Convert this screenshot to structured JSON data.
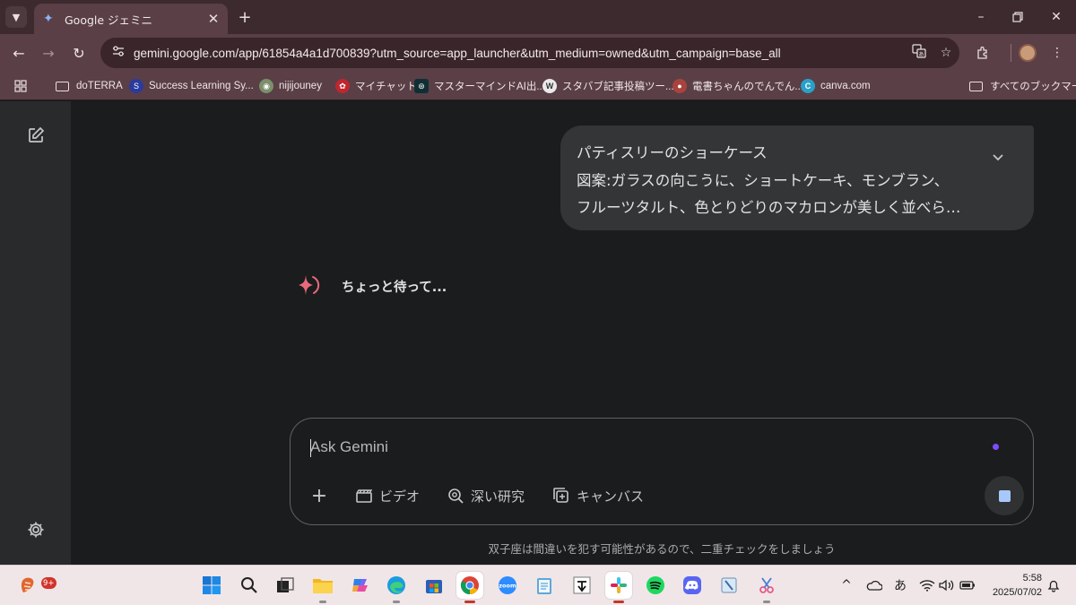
{
  "browser": {
    "tab": {
      "title": "Google ジェミニ",
      "favicon": "gemini-sparkle-icon",
      "close_glyph": "✕"
    },
    "new_tab_glyph": "+",
    "url": "gemini.google.com/app/61854a4a1d700839?utm_source=app_launcher&utm_medium=owned&utm_campaign=base_all",
    "bookmarks": [
      {
        "label": "doTERRA",
        "icon": "folder-icon"
      },
      {
        "label": "Success Learning Sy...",
        "icon": "s-logo-icon"
      },
      {
        "label": "nijijouney",
        "icon": "niji-icon"
      },
      {
        "label": "マイチャット",
        "icon": "mychat-icon"
      },
      {
        "label": "マスターマインドAI出...",
        "icon": "mastermind-icon"
      },
      {
        "label": "スタバブ記事投稿ツー...",
        "icon": "wordpress-icon"
      },
      {
        "label": "電書ちゃんのでんでん...",
        "icon": "denden-icon"
      },
      {
        "label": "canva.com",
        "icon": "canva-icon"
      }
    ],
    "all_bookmarks": "すべてのブックマーク"
  },
  "conversation": {
    "user_message_lines": [
      "パティスリーのショーケース",
      "図案:ガラスの向こうに、ショートケーキ、モンブラン、",
      "フルーツタルト、色とりどりのマカロンが美しく並べら…"
    ],
    "status_text": "ちょっと待って..."
  },
  "composer": {
    "placeholder": "Ask Gemini",
    "tools": [
      {
        "label": "ビデオ",
        "icon": "video-icon"
      },
      {
        "label": "深い研究",
        "icon": "deep-research-icon"
      },
      {
        "label": "キャンバス",
        "icon": "canvas-icon"
      }
    ]
  },
  "disclaimer": "双子座は間違いを犯す可能性があるので、二重チェックをしましょう",
  "taskbar": {
    "notification_badge": "9+",
    "ime_label": "あ",
    "time": "5:58",
    "date": "2025/07/02"
  },
  "colors": {
    "chrome_tab_strip": "#3c2a2e",
    "chrome_toolbar": "#5a3f46",
    "gemini_bg": "#1b1c1d",
    "sidebar_bg": "#282a2c",
    "bubble_bg": "#333537",
    "accent_dot": "#7c4dff",
    "stop_square": "#a8c7fa"
  }
}
